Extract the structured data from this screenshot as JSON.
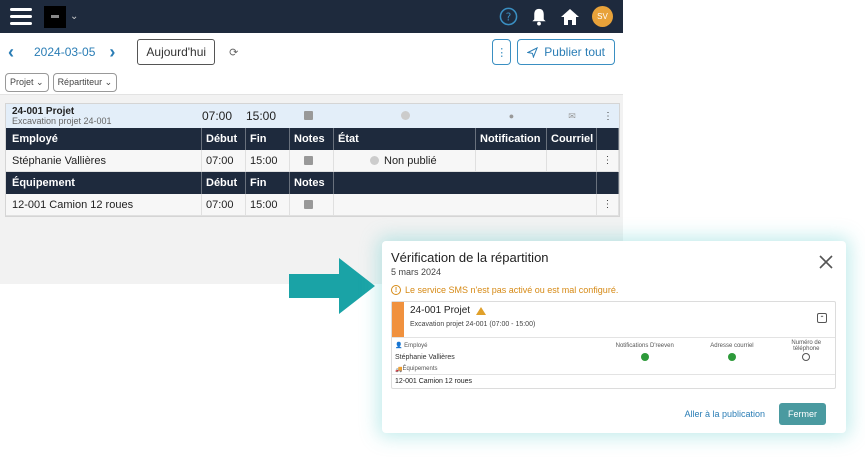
{
  "topbar": {
    "avatar_initials": "SV",
    "colors": {
      "bar": "#1e2a3d",
      "avatar": "#e8a23a"
    }
  },
  "datebar": {
    "date": "2024-03-05",
    "today_label": "Aujourd'hui",
    "publish_label": "Publier tout"
  },
  "filters": [
    "Projet",
    "Répartiteur"
  ],
  "grid": {
    "project": {
      "name": "24-001 Projet",
      "subtitle": "Excavation projet 24-001",
      "start": "07:00",
      "end": "15:00"
    },
    "employee_headers": [
      "Employé",
      "Début",
      "Fin",
      "Notes",
      "État",
      "Notification",
      "Courriel"
    ],
    "employee_row": {
      "name": "Stéphanie Vallières",
      "start": "07:00",
      "end": "15:00",
      "status": "Non publié"
    },
    "equipment_headers": [
      "Équipement",
      "Début",
      "Fin",
      "Notes"
    ],
    "equipment_row": {
      "name": "12-001 Camion 12 roues",
      "start": "07:00",
      "end": "15:00"
    }
  },
  "modal": {
    "title": "Vérification de la répartition",
    "date": "5 mars 2024",
    "warning": "Le service SMS n'est pas activé ou est mal configuré.",
    "card": {
      "title": "24-001 Projet",
      "subtitle": "Excavation projet 24-001 (07:00 - 15:00)",
      "employee_label": "Employé",
      "col_notifications": "Notifications D'reeven",
      "col_email": "Adresse courriel",
      "col_phone": "Numéro de téléphone",
      "employee_name": "Stéphanie Vallières",
      "equipment_label": "Équipements",
      "equipment_name": "12-001 Camion 12 roues"
    },
    "link_label": "Aller à la publication",
    "close_label": "Fermer",
    "colors": {
      "accent_bar": "#f0913e",
      "warning": "#d68a16",
      "ok": "#2d9a3a",
      "close_button": "#4a9aa0"
    }
  },
  "arrow": {
    "color": "#1aa3a6"
  }
}
